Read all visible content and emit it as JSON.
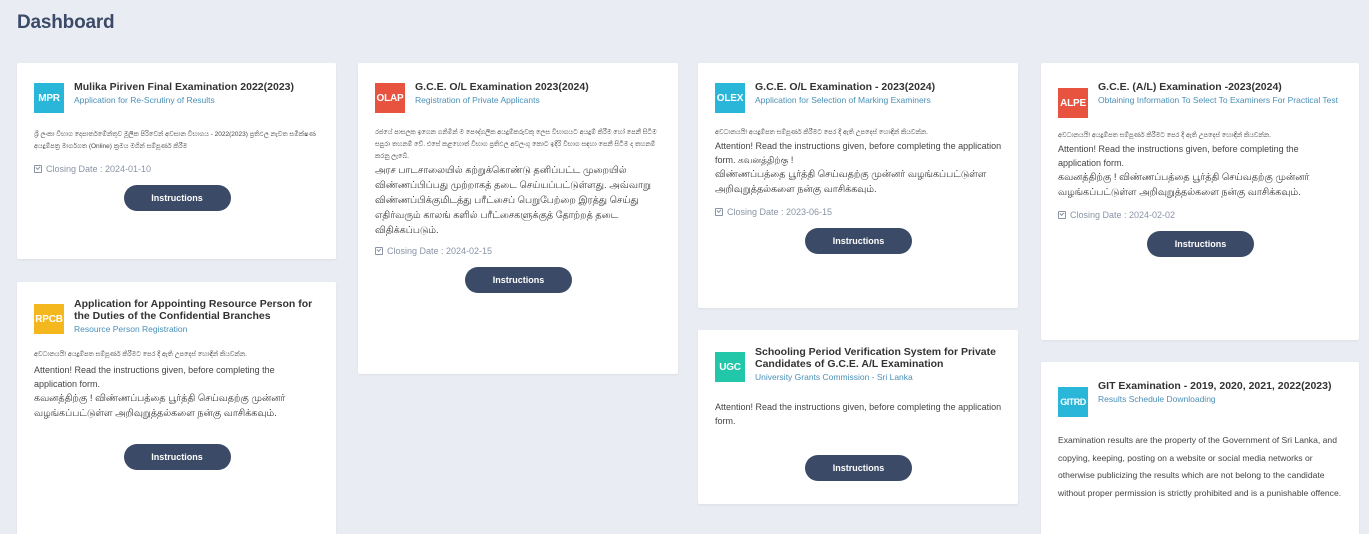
{
  "page": {
    "title": "Dashboard"
  },
  "cards": {
    "mpr": {
      "code": "MPR",
      "color": "#29b6d8",
      "title": "Mulika Piriven Final Examination 2022(2023)",
      "subtitle": "Application for Re-Scrutiny of Results",
      "body_si": "ශ්‍රී ලංකා විභාග දෙපාර්තමේන්තුව මූලික පිරිවෙන් අවසාන විභාගය - 2022(2023) ප්‍රතිඵල නැවත සමීක්ෂණ අයදුම්පත්‍ර මාර්ගගත (Online) ක්‍රමය මගින් සම්පූර්ණ කිරීම",
      "closing": "Closing Date : 2024-01-10",
      "button": "Instructions"
    },
    "olap": {
      "code": "OLAP",
      "color": "#e8533f",
      "title": "G.C.E. O/L Examination 2023(2024)",
      "subtitle": "Registration of Private Applicants",
      "body_si": "රජයේ පාසලක ඉගෙන ගනිමින් ම පෞද්ගලික අයදුම්කරුවකු ලෙස විභාගයට අයදුම් කිරීම හෝ පෙනී සිටීම සපුරා තහනම් වේ. එසේ කළහොත් විභාග ප්‍රතිඵල අවලංගු කොට ඉදිරි විභාග සඳහා පෙනී සිටීම ද තහනම් කරනු ලැබේ.",
      "body_ta": "அரச பாடசாலையில் கற்றுக்கொண்டு தனிப்பட்ட முறையில் விண்ணப்பிப்பது முற்றாகத் தடை செய்யப்பட்டுள்ளது. அவ்வாறு விண்ணப்பிக்குமிடத்து பரீட்சைப் பெறுபேற்றை இரத்து செய்து எதிர்வரும் காலங் களில் பரீட்சைகளுக்குத் தோற்றத் தடை விதிக்கப்படும்.",
      "closing": "Closing Date : 2024-02-15",
      "button": "Instructions"
    },
    "olex": {
      "code": "OLEX",
      "color": "#29b6d8",
      "title": "G.C.E. O/L Examination - 2023(2024)",
      "subtitle": "Application for Selection of Marking Examiners",
      "body_si": "අවධානයයි! අයදුම්පත සම්පූර්ණ කිරීමට පෙර දී ඇති උපදෙස් හොඳින් කියවන්න.",
      "body_mixed": "Attention! Read the instructions given, before completing the application form. கவனத்திற்கு !",
      "body_ta": "விண்ணப்பத்தை பூர்த்தி செய்வதற்கு முன்னர் வழங்கப்பட்டுள்ள அறிவுறுத்தல்களை நன்கு வாசிக்கவும்.",
      "closing": "Closing Date : 2023-06-15",
      "button": "Instructions"
    },
    "alpe": {
      "code": "ALPE",
      "color": "#e8533f",
      "title": "G.C.E. (A/L) Examination -2023(2024)",
      "subtitle": "Obtaining Information To Select To Examiners For Practical Test",
      "body_si": "අවධානයයි! අයදුම්පත සම්පූර්ණ කිරීමට පෙර දී ඇති උපදෙස් හොඳින් කියවන්න.",
      "body_en": "Attention! Read the instructions given, before completing the application form.",
      "body_ta": "கவனத்திற்கு ! விண்ணப்பத்தை பூர்த்தி செய்வதற்கு முன்னர் வழங்கப்பட்டுள்ள அறிவுறுத்தல்களை நன்கு வாசிக்கவும்.",
      "closing": "Closing Date : 2024-02-02",
      "button": "Instructions"
    },
    "rpcb": {
      "code": "RPCB",
      "color": "#f5b71e",
      "title": "Application for Appointing Resource Person for the Duties of the Confidential Branches",
      "subtitle": "Resource Person Registration",
      "body_si": "අවධානයයි! අයදුම්පත සම්පූර්ණ කිරීමට පෙර දී ඇති උපදෙස් හොඳින් කියවන්න.",
      "body_en": "Attention! Read the instructions given, before completing the application form.",
      "body_ta": "கவனத்திற்கு ! விண்ணப்பத்தை பூர்த்தி செய்வதற்கு முன்னர் வழங்கப்பட்டுள்ள அறிவுறுத்தல்களை நன்கு வாசிக்கவும்.",
      "button": "Instructions"
    },
    "ugc": {
      "code": "UGC",
      "color": "#22c7a9",
      "title": "Schooling Period Verification System for Private Candidates of G.C.E. A/L Examination",
      "subtitle": "University Grants Commission - Sri Lanka",
      "body_en": "Attention! Read the instructions given, before completing the application form.",
      "button": "Instructions"
    },
    "gitrd": {
      "code": "GITRD",
      "color": "#29b6d8",
      "title": "GIT Examination - 2019, 2020, 2021, 2022(2023)",
      "subtitle": "Results Schedule Downloading",
      "body_en": "Examination results are the property of the Government of Sri Lanka, and copying, keeping, posting on a website or social media networks or otherwise publicizing the results which are not belong to the candidate without proper permission is strictly prohibited and is a punishable offence."
    }
  }
}
